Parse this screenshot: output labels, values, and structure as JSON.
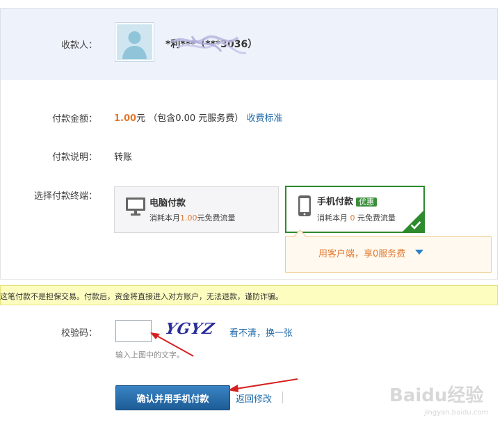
{
  "payee": {
    "label": "收款人：",
    "name": "*利***（***3036）"
  },
  "payment": {
    "amount_label": "付款金额：",
    "amount": "1.00",
    "amount_unit": "元",
    "fee_note": "（包含0.00 元服务费）",
    "fee_link": "收费标准",
    "description_label": "付款说明：",
    "description": "转账",
    "terminal_label": "选择付款终端："
  },
  "options": {
    "pc": {
      "title": "电脑付款",
      "sub_prefix": "消耗本月",
      "sub_value": "1.00",
      "sub_suffix": "元免费流量"
    },
    "mobile": {
      "title": "手机付款",
      "badge": "优惠",
      "sub_prefix": "消耗本月",
      "sub_value": "0",
      "sub_suffix": "元免费流量"
    }
  },
  "client_tip": {
    "text": "用客户端，享0服务费"
  },
  "warning": {
    "text": "这笔付款不是担保交易。付款后，资金将直接进入对方账户，无法退款，谨防诈骗。"
  },
  "captcha": {
    "label": "校验码：",
    "image_text": "YGYZ",
    "refresh_link": "看不清，换一张",
    "hint": "输入上图中的文字。"
  },
  "actions": {
    "confirm": "确认并用手机付款",
    "back": "返回修改"
  },
  "watermark": {
    "brand": "Baidu经验",
    "url": "jingyan.baidu.com"
  },
  "colors": {
    "accent_orange": "#e4782f",
    "link_blue": "#1f6aa8",
    "select_green": "#2d8a2d",
    "button_blue": "#2a6fae"
  }
}
